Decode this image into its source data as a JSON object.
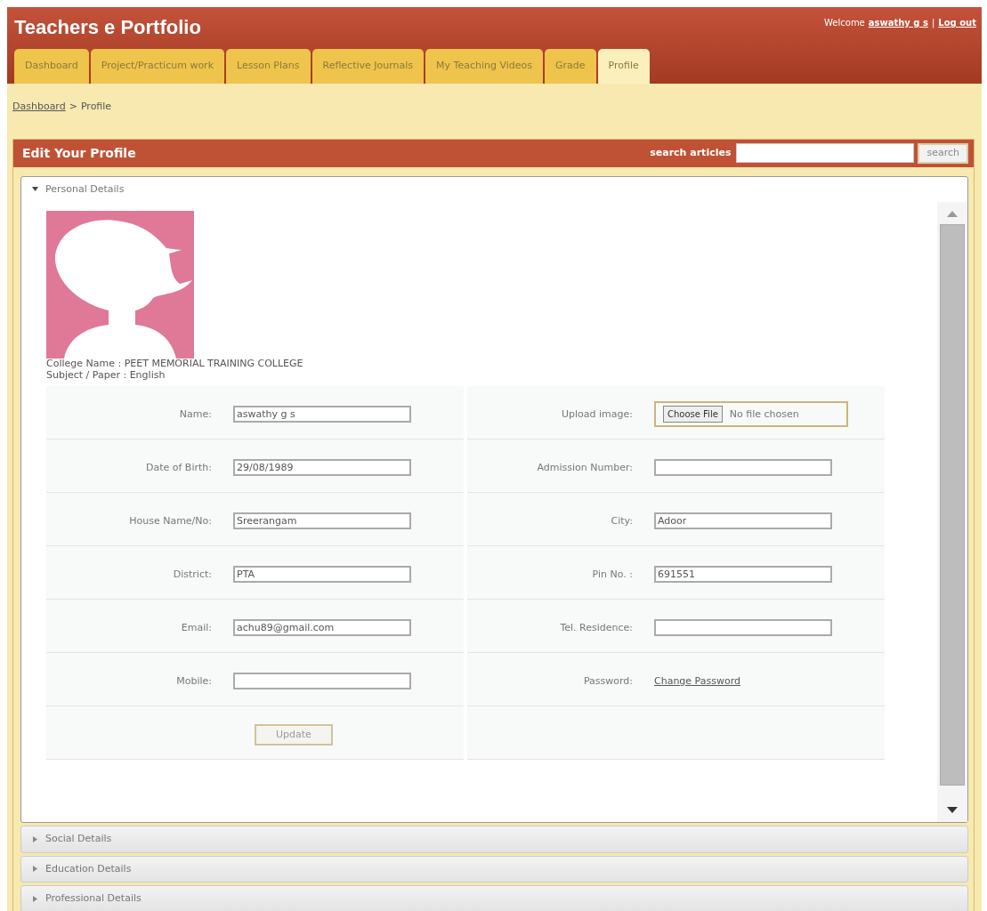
{
  "header": {
    "title": "Teachers e Portfolio",
    "welcome": "Welcome",
    "user": "aswathy g s",
    "separator": "|",
    "logout": "Log out"
  },
  "tabs": [
    {
      "label": "Dashboard",
      "selected": false
    },
    {
      "label": "Project/Practicum work",
      "selected": false
    },
    {
      "label": "Lesson Plans",
      "selected": false
    },
    {
      "label": "Reflective Journals",
      "selected": false
    },
    {
      "label": "My Teaching Videos",
      "selected": false
    },
    {
      "label": "Grade",
      "selected": false
    },
    {
      "label": "Profile",
      "selected": true
    }
  ],
  "breadcrumb": {
    "link": "Dashboard",
    "separator": ">",
    "current": "Profile"
  },
  "panel": {
    "title": "Edit Your Profile",
    "search_label": "search articles",
    "search_button": "search"
  },
  "sections": [
    {
      "title": "Personal Details",
      "expanded": true
    },
    {
      "title": "Social Details",
      "expanded": false
    },
    {
      "title": "Education Details",
      "expanded": false
    },
    {
      "title": "Professional Details",
      "expanded": false
    }
  ],
  "profile": {
    "info": [
      "College Name : PEET MEMORIAL TRAINING COLLEGE",
      "Subject / Paper : English"
    ]
  },
  "form": {
    "rows": [
      {
        "left": {
          "label": "Name:",
          "kind": "text",
          "value": "aswathy g s"
        },
        "right": {
          "label": "Upload image:",
          "kind": "file",
          "button": "Choose File",
          "value": "No file chosen"
        }
      },
      {
        "left": {
          "label": "Date of Birth:",
          "kind": "text",
          "value": "29/08/1989"
        },
        "right": {
          "label": "Admission Number:",
          "kind": "text"
        }
      },
      {
        "left": {
          "label": "House Name/No:",
          "kind": "text",
          "value": "Sreerangam"
        },
        "right": {
          "label": "City:",
          "kind": "text",
          "value": "Adoor"
        }
      },
      {
        "left": {
          "label": "District:",
          "kind": "text",
          "value": "PTA"
        },
        "right": {
          "label": "Pin No. :",
          "kind": "text",
          "value": "691551"
        }
      },
      {
        "left": {
          "label": "Email:",
          "kind": "text",
          "value": "achu89@gmail.com"
        },
        "right": {
          "label": "Tel. Residence:",
          "kind": "text"
        }
      },
      {
        "left": {
          "label": "Mobile:",
          "kind": "text"
        },
        "right": {
          "label": "Password:",
          "kind": "link",
          "value": "Change Password"
        }
      },
      {
        "left": {
          "kind": "button",
          "value": "Update"
        }
      }
    ]
  }
}
